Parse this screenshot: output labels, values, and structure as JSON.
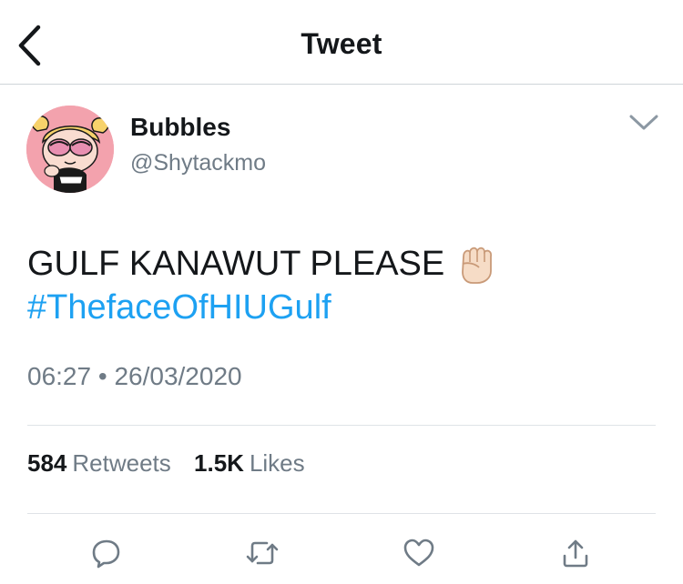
{
  "header": {
    "title": "Tweet",
    "back_icon": "chevron-left-icon"
  },
  "author": {
    "display_name": "Bubbles",
    "handle": "@Shytackmo",
    "menu_icon": "chevron-down-icon"
  },
  "tweet": {
    "text": "GULF KANAWUT PLEASE",
    "emoji": "raised-fist-emoji",
    "hashtag": "#ThefaceOfHIUGulf"
  },
  "meta": {
    "time": "06:27",
    "separator": "•",
    "date": "26/03/2020"
  },
  "stats": {
    "retweets_count": "584",
    "retweets_label": "Retweets",
    "likes_count": "1.5K",
    "likes_label": "Likes"
  },
  "actions": [
    {
      "icon": "reply-icon"
    },
    {
      "icon": "retweet-icon"
    },
    {
      "icon": "heart-icon"
    },
    {
      "icon": "share-icon"
    }
  ],
  "colors": {
    "accent": "#1da1f2",
    "secondary_text": "#6f7b86",
    "primary_text": "#14171a",
    "divider": "#dfe3e7"
  }
}
